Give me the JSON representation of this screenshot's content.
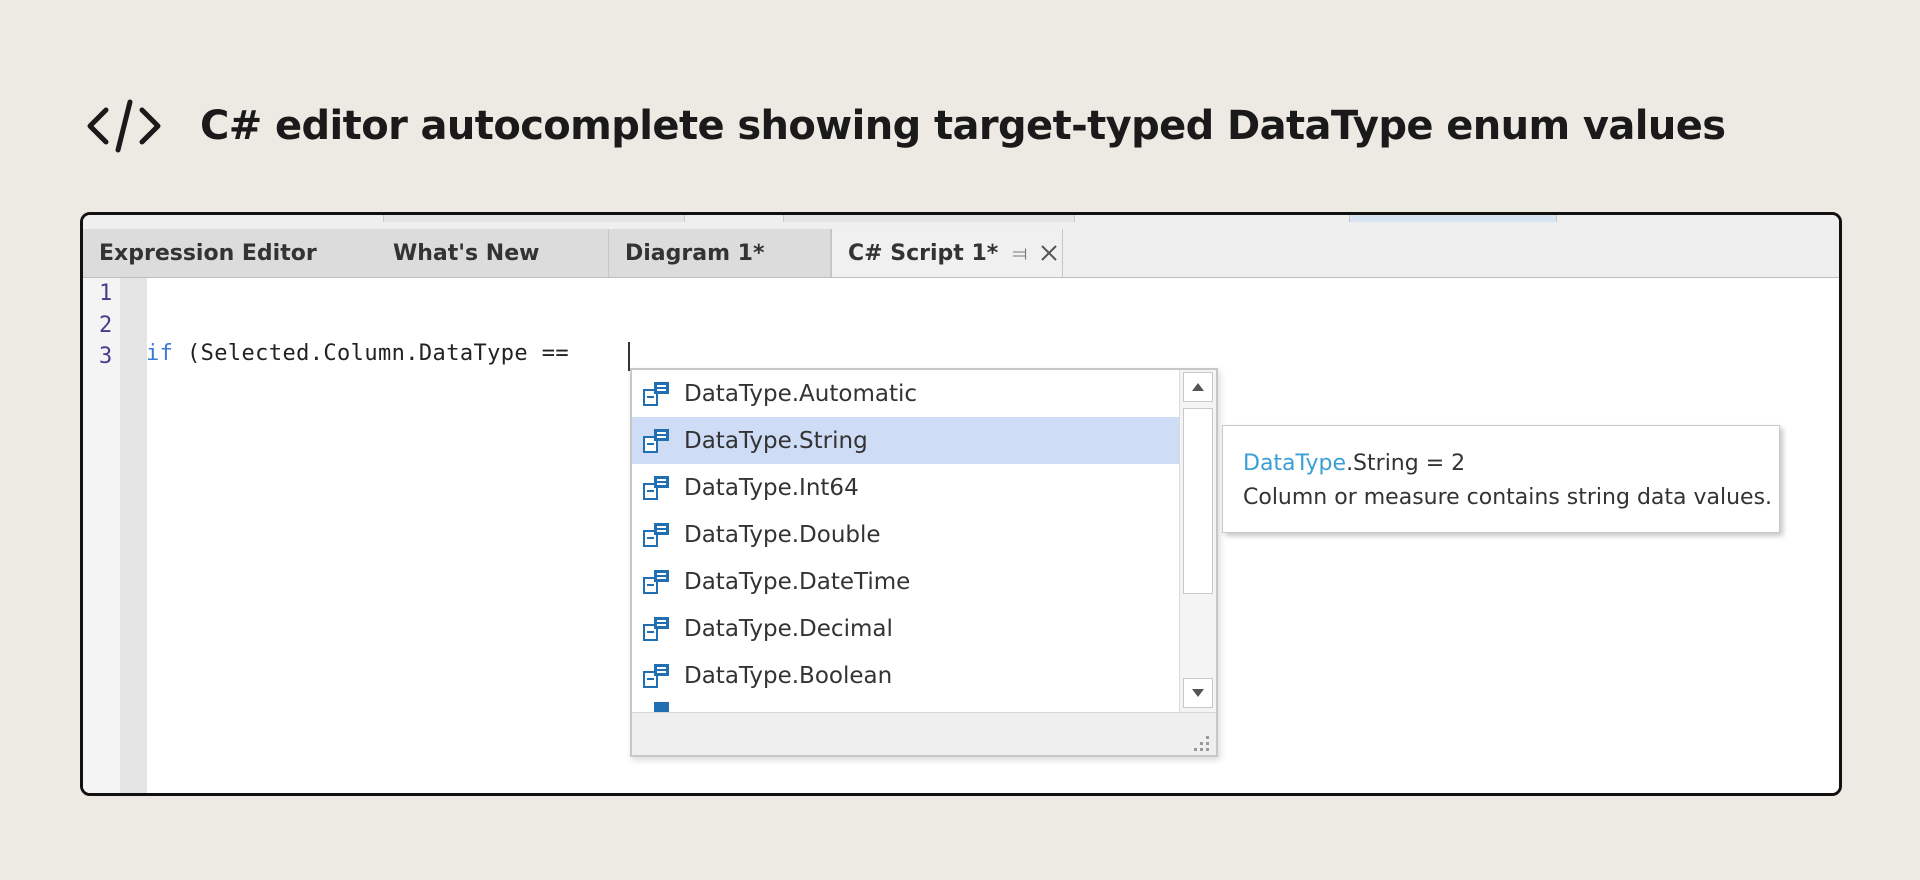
{
  "header": {
    "icon": "code-icon",
    "title": "C# editor autocomplete showing target-typed DataType enum values"
  },
  "tabs": [
    {
      "label": "Expression Editor",
      "active": false
    },
    {
      "label": "What's New",
      "active": false
    },
    {
      "label": "Diagram 1*",
      "active": false
    },
    {
      "label": "C# Script 1*",
      "active": true,
      "icons": [
        "pin-icon",
        "close-icon"
      ]
    }
  ],
  "editor": {
    "line_numbers": [
      "1",
      "2",
      "3"
    ],
    "code": {
      "keyword": "if",
      "rest": " (Selected.Column.DataType == "
    }
  },
  "autocomplete": {
    "item_icon": "enum-member-icon",
    "items": [
      "DataType.Automatic",
      "DataType.String",
      "DataType.Int64",
      "DataType.Double",
      "DataType.DateTime",
      "DataType.Decimal",
      "DataType.Boolean"
    ],
    "selected_index": 1
  },
  "tooltip": {
    "type_name": "DataType",
    "member": ".String = 2",
    "description": "Column or measure contains string data values."
  },
  "colors": {
    "background": "#ede9e3",
    "keyword": "#3a7bd5",
    "selection": "#cfdcf5",
    "tooltip_type": "#3b9fd6",
    "line_number": "#4b3a8c"
  }
}
